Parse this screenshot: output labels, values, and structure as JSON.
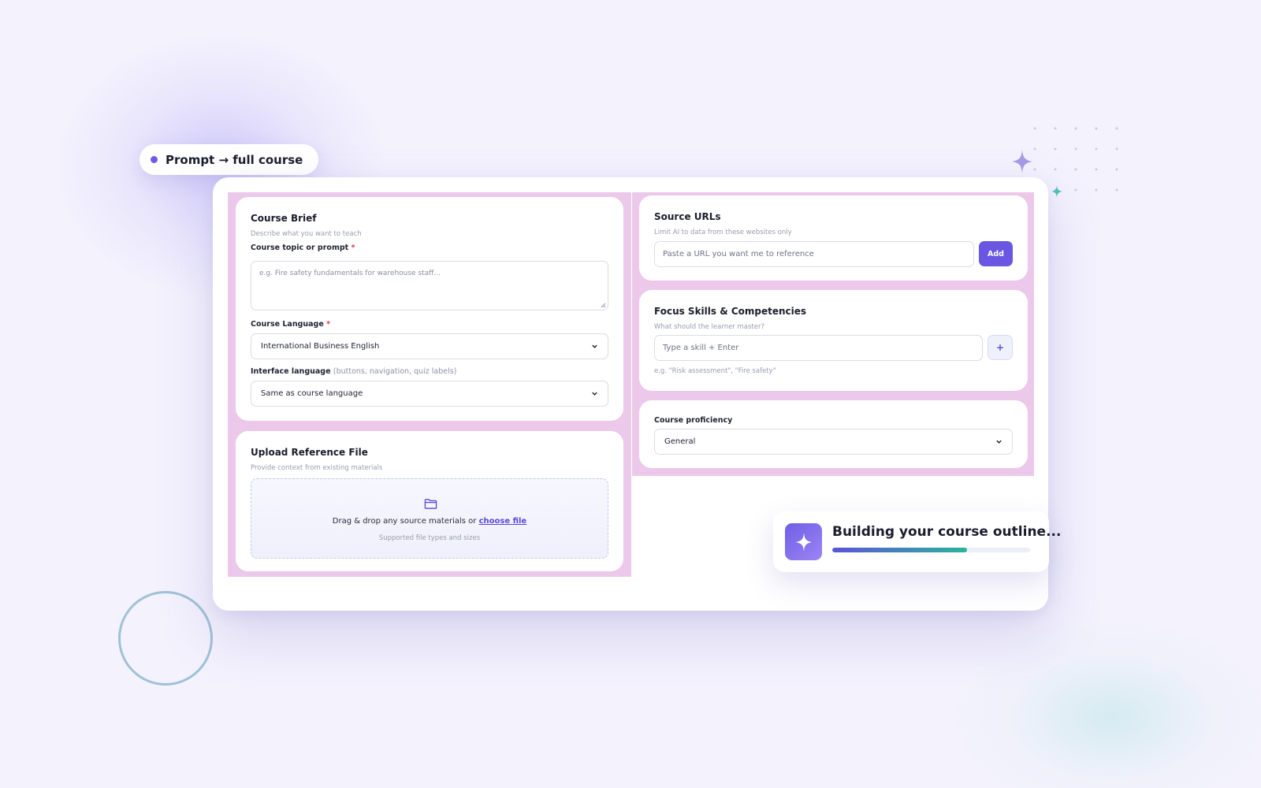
{
  "badge": {
    "label": "Prompt → full course"
  },
  "course_brief": {
    "title": "Course Brief",
    "subtitle": "Describe what you want to teach",
    "topic_label": "Course topic or prompt",
    "required_mark": "*",
    "topic_placeholder": "e.g. Fire safety fundamentals for warehouse staff...",
    "language_label": "Course Language",
    "language_value": "International Business English",
    "interface_label": "Interface language",
    "interface_hint": "(buttons, navigation, quiz labels)",
    "interface_value": "Same as course language"
  },
  "upload": {
    "title": "Upload Reference File",
    "subtitle": "Provide context from existing materials",
    "drop_text": "Drag & drop any source materials or",
    "choose_link": "choose file",
    "supported_text": "Supported file types and sizes"
  },
  "source_urls": {
    "title": "Source URLs",
    "subtitle": "Limit AI to data from these websites only",
    "url_placeholder": "Paste a URL you want me to reference",
    "add_label": "Add"
  },
  "focus_skills": {
    "title": "Focus Skills & Competencies",
    "subtitle": "What should the learner master?",
    "skill_placeholder": "Type a skill + Enter",
    "add_glyph": "+",
    "example": "e.g. \"Risk assessment\", \"Fire safety\""
  },
  "proficiency": {
    "label": "Course proficiency",
    "value": "General"
  },
  "toast": {
    "title": "Building your course outline...",
    "progress": 0.68
  },
  "colors": {
    "accent": "#6b56e4",
    "card_background": "#ecc9ea",
    "progress_start": "#5b54d8",
    "progress_end": "#2bb39c"
  },
  "icons": {
    "badge": "dot-icon",
    "upload": "folder-icon",
    "toast": "sparkle-icon",
    "decorations": [
      "sparkle-icon",
      "dot-grid",
      "ring"
    ]
  }
}
